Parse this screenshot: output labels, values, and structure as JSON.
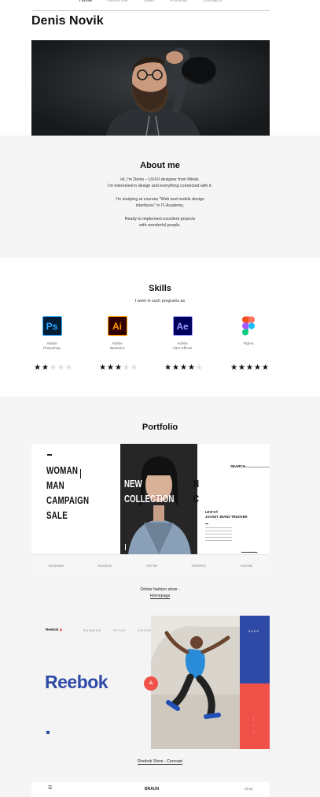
{
  "nav": {
    "items": [
      "Home",
      "About me",
      "Skills",
      "Portfolio",
      "Contacts"
    ]
  },
  "header": {
    "name": "Denis Novik"
  },
  "about": {
    "title": "About me",
    "line1": "Hi, I'm Denis – UX/UI designer from Minsk.",
    "line2": "I'm interested in design and everything connected with it.",
    "line3": "I'm studying at courses \"Web and mobile design",
    "line4": "interfaces\" in IT-Academy.",
    "line5": "Ready to implement excellent projects",
    "line6": "with wonderful people."
  },
  "skills": {
    "title": "Skills",
    "subtitle": "I work in such programs as",
    "items": [
      {
        "abbr": "Ps",
        "label1": "Adobe",
        "label2": "Photoshop",
        "rating": 2,
        "max": 5,
        "color": "#31a8ff",
        "bg": "#001e36"
      },
      {
        "abbr": "Ai",
        "label1": "Adobe",
        "label2": "Illustrator",
        "rating": 3,
        "max": 5,
        "color": "#ff9a00",
        "bg": "#330000"
      },
      {
        "abbr": "Ae",
        "label1": "Adobe",
        "label2": "After Effects",
        "rating": 4,
        "max": 5,
        "color": "#9999ff",
        "bg": "#00005b"
      },
      {
        "abbr": "",
        "label1": "Figma",
        "label2": "",
        "rating": 5,
        "max": 5,
        "color": "",
        "bg": ""
      }
    ]
  },
  "portfolio": {
    "title": "Portfolio",
    "project1": {
      "caption1": "Online fashion store -",
      "caption2": "Homepage",
      "headline1": "WOMAN",
      "headline2": "MAN",
      "headline3": "CAMPAIGN",
      "headline4": "SALE",
      "overlay1": "NEW",
      "overlay2": "COLLECTION",
      "search": "SEARCH",
      "product1": "LEVI'S®",
      "product2": "JACKET JEANS TRUCKER",
      "footer_items": [
        "INSTAGRAM",
        "FACEBOOK",
        "TWITTER",
        "PINTEREST",
        "YOUTUBE"
      ]
    },
    "project2": {
      "caption": "Reebok Store - Concept",
      "brand": "Reebok",
      "nav_items": [
        "RUNNING",
        "STYLE",
        "CROSSFIT"
      ],
      "shop": "SHOP"
    },
    "project3": {
      "brand": "BRAUN",
      "shop": "Shop"
    }
  }
}
